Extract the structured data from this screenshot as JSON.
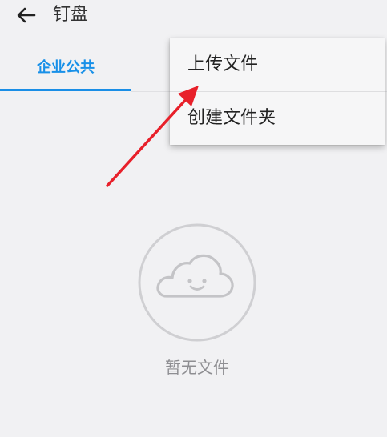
{
  "header": {
    "back_icon": "arrow-left-icon",
    "title": "钉盘"
  },
  "tabs": [
    {
      "label": "企业公共",
      "active": true
    }
  ],
  "menu": {
    "items": [
      {
        "label": "上传文件"
      },
      {
        "label": "创建文件夹"
      }
    ]
  },
  "empty_state": {
    "icon": "smiling-cloud-icon",
    "text": "暂无文件"
  },
  "colors": {
    "accent": "#1a8ee6",
    "annotation_arrow": "#e8202a",
    "background": "#f1f1f3"
  }
}
